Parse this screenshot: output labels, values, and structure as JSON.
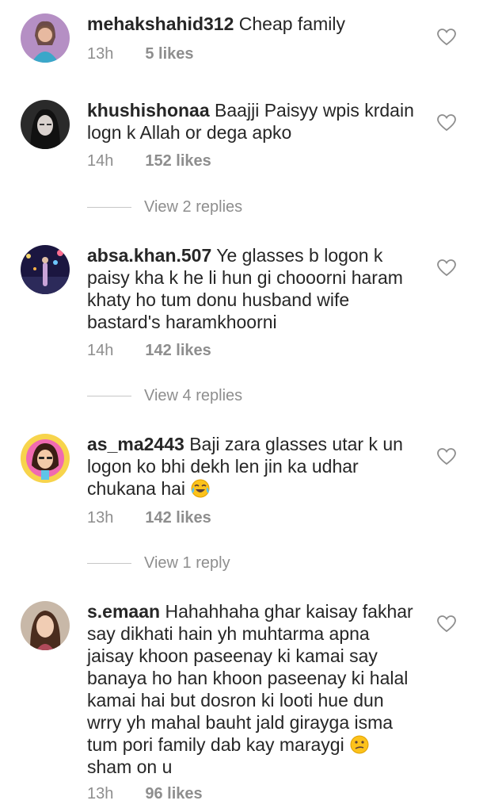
{
  "comments": [
    {
      "username": "mehakshahid312",
      "text": "Cheap family",
      "time": "13h",
      "likes": "5 likes",
      "avatar": "avatar-girl-colorful"
    },
    {
      "username": "khushishonaa",
      "text": "Baajji Paisyy wpis krdain logn k Allah or dega apko",
      "time": "14h",
      "likes": "152 likes",
      "avatar": "avatar-girl-dark"
    },
    {
      "username": "absa.khan.507",
      "text": "Ye glasses b logon k paisy kha k he li hun gi chooorni haram khaty ho tum donu husband wife bastard's haramkhoorni",
      "time": "14h",
      "likes": "142 likes",
      "avatar": "avatar-night-city"
    },
    {
      "username": "as_ma2443",
      "text": "Baji zara glasses utar k un logon ko bhi dekh len jin ka udhar chukana hai",
      "time": "13h",
      "likes": "142 likes",
      "avatar": "avatar-cartoon-girl",
      "emoji": "tears-of-joy"
    },
    {
      "username": "s.emaan",
      "text": "Hahahhaha ghar kaisay fakhar say dikhati hain yh muhtarma apna jaisay khoon paseenay ki kamai say banaya ho han khoon paseenay ki halal kamai hai but dosron ki looti hue dun wrry yh mahal bauht jald girayga isma tum pori family dab kay maraygi",
      "text2": "sham on u",
      "time": "13h",
      "likes": "96 likes",
      "avatar": "avatar-woman",
      "emoji": "confused-face"
    }
  ],
  "replies": [
    {
      "label": "View 2 replies"
    },
    {
      "label": "View 4 replies"
    },
    {
      "label": "View 1 reply"
    }
  ],
  "icons": {
    "like": "heart-outline-icon"
  },
  "colors": {
    "text": "#262626",
    "meta": "#8e8e8e",
    "divider": "#c7c7c7",
    "background": "#ffffff"
  }
}
